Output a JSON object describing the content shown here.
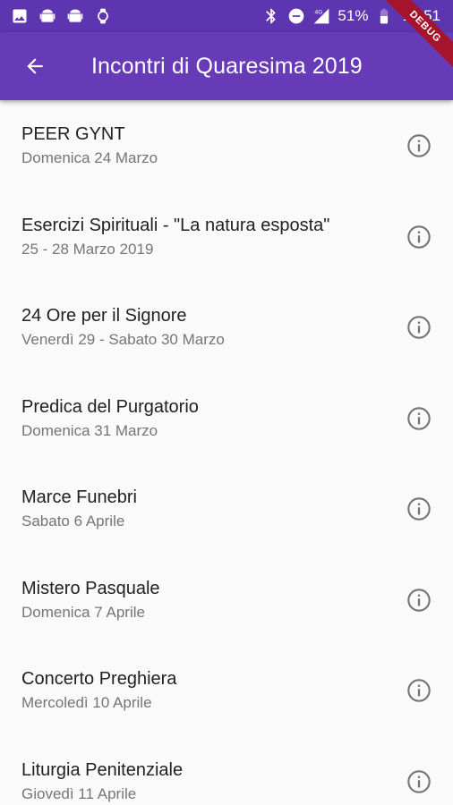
{
  "status_bar": {
    "icons_left": [
      "image-icon",
      "android-icon",
      "android-icon",
      "watch-icon"
    ],
    "icons_right": [
      "bluetooth-icon",
      "do-not-disturb-icon",
      "signal-4g-icon"
    ],
    "battery": "51%",
    "time": "13:51"
  },
  "app_bar": {
    "title": "Incontri di Quaresima 2019",
    "back_icon": "arrow-back-icon",
    "color": "#673ab7"
  },
  "debug_banner": "DEBUG",
  "items": [
    {
      "title": "PEER GYNT",
      "subtitle": "Domenica 24 Marzo"
    },
    {
      "title": "Esercizi Spirituali - \"La natura esposta\"",
      "subtitle": "25 - 28 Marzo 2019"
    },
    {
      "title": "24 Ore per il Signore",
      "subtitle": "Venerdì 29 - Sabato 30 Marzo"
    },
    {
      "title": "Predica del Purgatorio",
      "subtitle": "Domenica 31 Marzo"
    },
    {
      "title": "Marce Funebri",
      "subtitle": "Sabato 6 Aprile"
    },
    {
      "title": "Mistero Pasquale",
      "subtitle": "Domenica 7 Aprile"
    },
    {
      "title": "Concerto Preghiera",
      "subtitle": "Mercoledì 10 Aprile"
    },
    {
      "title": "Liturgia Penitenziale",
      "subtitle": "Giovedì 11 Aprile"
    }
  ]
}
